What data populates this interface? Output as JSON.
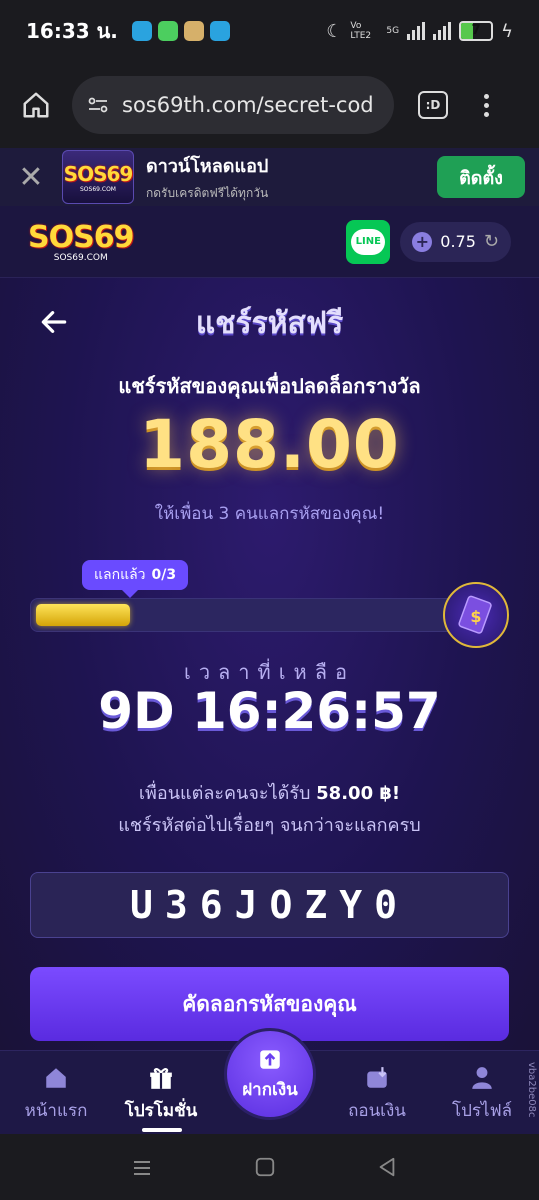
{
  "status_bar": {
    "time": "16:33 น.",
    "network": "5G",
    "volte": "Vo LTE2",
    "battery": "7",
    "battery_level": 0.07,
    "colors": {
      "telegram": "#2aa3df",
      "messages": "#4cce5f",
      "game": "#d6b06a"
    }
  },
  "browser": {
    "url": "sos69th.com/secret-cod",
    "tabs_label": ":D"
  },
  "app_banner": {
    "title": "ดาวน์โหลดแอป",
    "subtitle": "กดรับเครดิตฟรีได้ทุกวัน",
    "install_label": "ติดตั้ง",
    "logo_text": "SOS69",
    "logo_sub": "SOS69.COM"
  },
  "header": {
    "logo_text": "SOS69",
    "logo_sub": "SOS69.COM",
    "line_label": "LINE",
    "balance": "0.75"
  },
  "main": {
    "title": "แชร์รหัสฟรี",
    "headline": "แชร์รหัสของคุณเพื่อปลดล็อกรางวัล",
    "amount": "188.00",
    "subline": "ให้เพื่อน 3 คนแลกรหัสของคุณ!",
    "progress_label": "แลกแล้ว",
    "progress_count": "0/3",
    "progress_fill": 0.21,
    "time_left_label": "เวลาที่เหลือ",
    "timer": "9D 16:26:57",
    "info_line1_prefix": "เพื่อนแต่ละคนจะได้รับ",
    "info_line1_amount": "58.00 ฿!",
    "info_line2": "แชร์รหัสต่อไปเรื่อยๆ จนกว่าจะแลกครบ",
    "code": "U36JOZY0",
    "copy_button": "คัดลอกรหัสของคุณ"
  },
  "bottom_nav": {
    "home": "หน้าแรก",
    "promo": "โปรโมชั่น",
    "deposit": "ฝากเงิน",
    "withdraw": "ถอนเงิน",
    "profile": "โปรไฟล์",
    "side_tag": "vba2be08c"
  }
}
